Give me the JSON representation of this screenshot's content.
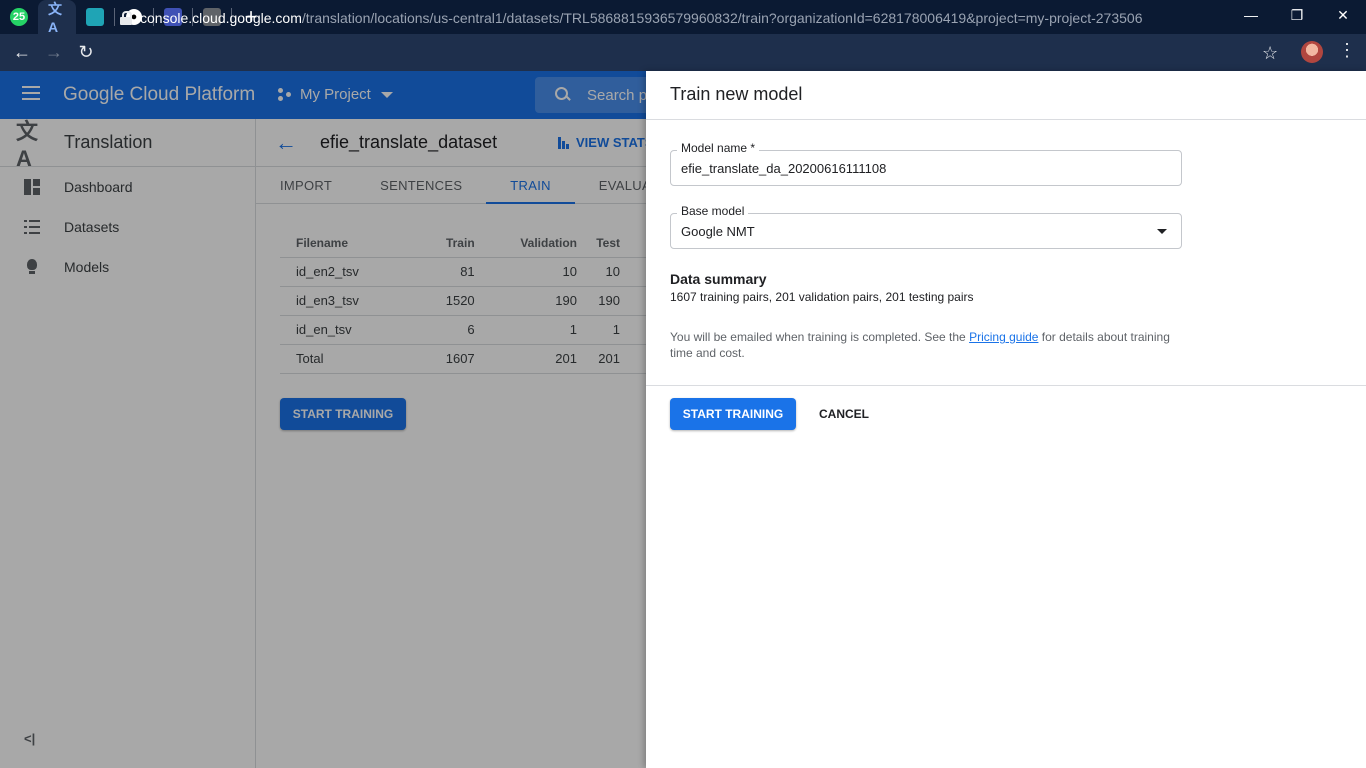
{
  "browser": {
    "tabs": [
      {
        "icon": "whatsapp-icon",
        "badge": "25",
        "color": "#25d366"
      },
      {
        "icon": "translate-icon",
        "color": "#4285f4"
      },
      {
        "icon": "classroom-icon",
        "color": "#0f9d58"
      },
      {
        "icon": "github-icon",
        "color": "#ffffff"
      },
      {
        "icon": "globe-icon",
        "color": "#6b7cff"
      },
      {
        "icon": "contact-icon",
        "color": "#9aa0a6"
      }
    ],
    "url_host": "console.cloud.google.com",
    "url_path": "/translation/locations/us-central1/datasets/TRL5868815936579960832/train?organizationId=628178006419&project=my-project-273506"
  },
  "header": {
    "title": "Google Cloud Platform",
    "project": "My Project",
    "search_placeholder": "Search p"
  },
  "sidebar": {
    "title": "Translation",
    "items": [
      {
        "label": "Dashboard"
      },
      {
        "label": "Datasets"
      },
      {
        "label": "Models"
      }
    ]
  },
  "main": {
    "dataset_title": "efie_translate_dataset",
    "view_stats": "VIEW STATS",
    "tabs": [
      "IMPORT",
      "SENTENCES",
      "TRAIN",
      "EVALUATE"
    ],
    "active_tab": "TRAIN",
    "table": {
      "headers": [
        "Filename",
        "Train",
        "Validation",
        "Test"
      ],
      "rows": [
        [
          "id_en2_tsv",
          "81",
          "10",
          "10"
        ],
        [
          "id_en3_tsv",
          "1520",
          "190",
          "190"
        ],
        [
          "id_en_tsv",
          "6",
          "1",
          "1"
        ],
        [
          "Total",
          "1607",
          "201",
          "201"
        ]
      ]
    },
    "start_button": "START TRAINING"
  },
  "panel": {
    "title": "Train new model",
    "model_name_label": "Model name *",
    "model_name_value": "efie_translate_da_20200616111108",
    "base_model_label": "Base model",
    "base_model_value": "Google NMT",
    "data_summary_title": "Data summary",
    "data_summary_text": "1607 training pairs, 201 validation pairs, 201 testing pairs",
    "note_before": "You will be emailed when training is completed. See the ",
    "note_link": "Pricing guide",
    "note_after": " for details about training time and cost.",
    "start_button": "START TRAINING",
    "cancel_button": "CANCEL"
  }
}
